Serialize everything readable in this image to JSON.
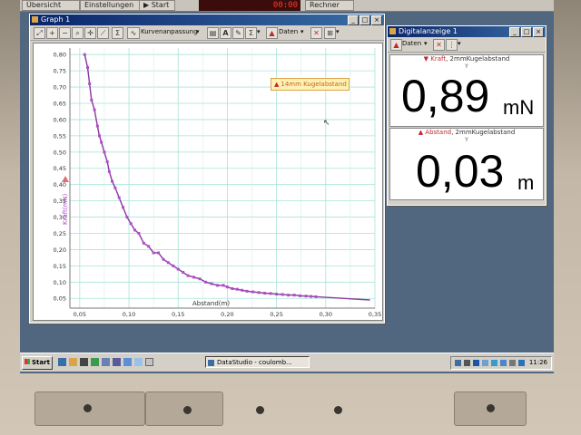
{
  "top_bar": {
    "button1": "Übersicht",
    "button2": "Einstellungen",
    "start": "Start",
    "timer": "00:00",
    "calculator": "Rechner"
  },
  "graph_window": {
    "title": "Graph 1",
    "toolbar": {
      "curve_fit": "Kurvenanpassung",
      "data": "Daten"
    },
    "legend": "14mm Kugelabstand",
    "y_axis_label": "Kraft(mN)",
    "x_axis_label": "Abstand(m)"
  },
  "chart_data": {
    "type": "scatter",
    "xlabel": "Abstand(m)",
    "ylabel": "Kraft(mN)",
    "xlim": [
      0.04,
      0.35
    ],
    "ylim": [
      0.02,
      0.82
    ],
    "x_ticks": [
      "0,05",
      "0,10",
      "0,15",
      "0,20",
      "0,25",
      "0,30",
      "0,35"
    ],
    "y_ticks": [
      "0,05",
      "0,10",
      "0,15",
      "0,20",
      "0,25",
      "0,30",
      "0,35",
      "0,40",
      "0,45",
      "0,50",
      "0,55",
      "0,60",
      "0,65",
      "0,70",
      "0,75",
      "0,80"
    ],
    "grid": true,
    "series": [
      {
        "name": "14mm Kugelabstand",
        "color": "#b24cc9",
        "x": [
          0.055,
          0.058,
          0.06,
          0.062,
          0.065,
          0.068,
          0.07,
          0.072,
          0.075,
          0.078,
          0.08,
          0.083,
          0.086,
          0.09,
          0.094,
          0.098,
          0.102,
          0.106,
          0.11,
          0.115,
          0.12,
          0.125,
          0.13,
          0.135,
          0.14,
          0.145,
          0.15,
          0.155,
          0.16,
          0.166,
          0.172,
          0.178,
          0.184,
          0.19,
          0.196,
          0.2,
          0.205,
          0.21,
          0.215,
          0.22,
          0.226,
          0.232,
          0.238,
          0.244,
          0.25,
          0.256,
          0.262,
          0.268,
          0.274,
          0.28,
          0.285,
          0.29
        ],
        "y": [
          0.8,
          0.76,
          0.71,
          0.66,
          0.63,
          0.58,
          0.55,
          0.53,
          0.5,
          0.47,
          0.44,
          0.41,
          0.39,
          0.36,
          0.33,
          0.3,
          0.28,
          0.26,
          0.25,
          0.22,
          0.21,
          0.19,
          0.19,
          0.17,
          0.16,
          0.15,
          0.14,
          0.13,
          0.12,
          0.115,
          0.11,
          0.1,
          0.095,
          0.09,
          0.09,
          0.085,
          0.08,
          0.078,
          0.075,
          0.072,
          0.07,
          0.068,
          0.066,
          0.065,
          0.063,
          0.062,
          0.06,
          0.06,
          0.058,
          0.057,
          0.056,
          0.055
        ]
      }
    ]
  },
  "digital_window": {
    "title": "Digitalanzeige 1",
    "data_button": "Daten",
    "panel1": {
      "label_name": "Kraft",
      "label_rest": ", 2mmKugelabstand",
      "axis": "Y",
      "value": "0,89",
      "unit": "mN"
    },
    "panel2": {
      "label_name": "Abstand",
      "label_rest": ", 2mmKugelabstand",
      "axis": "Y",
      "value": "0,03",
      "unit": "m"
    }
  },
  "taskbar": {
    "start": "Start",
    "task": "DataStudio - coulomb...",
    "clock": "11:26"
  }
}
